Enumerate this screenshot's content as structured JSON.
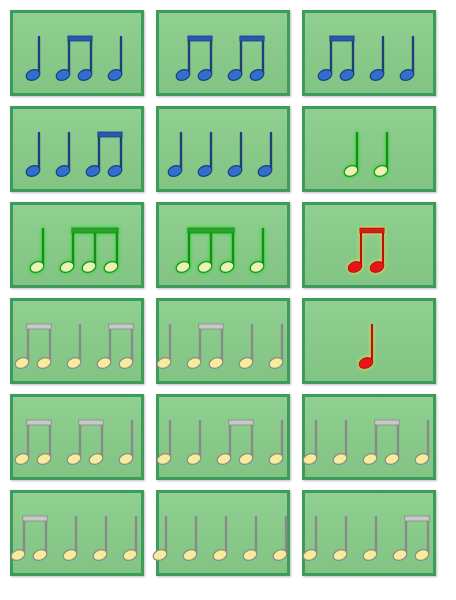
{
  "palette": {
    "blue": {
      "fill": "#2f6fd0",
      "stem": "#1f3f7a",
      "beam": "#2558b5",
      "glow": "none"
    },
    "green": {
      "fill": "#e9f3b4",
      "stem": "#1f8a1f",
      "beam": "#2aa12a",
      "glow": "#19e619"
    },
    "red": {
      "fill": "#e51616",
      "stem": "#c21010",
      "beam": "#d41a1a",
      "glow": "#ffe24a"
    },
    "cream": {
      "fill": "#f6ec9b",
      "stem": "#8a8a8a",
      "beam": "#c9c9c9",
      "glow": "none"
    }
  },
  "cards": [
    {
      "color": "blue",
      "groups": [
        "q",
        "e2",
        "q"
      ]
    },
    {
      "color": "blue",
      "groups": [
        "e2",
        "e2"
      ]
    },
    {
      "color": "blue",
      "groups": [
        "e2",
        "q",
        "q"
      ]
    },
    {
      "color": "blue",
      "groups": [
        "q",
        "q",
        "e2"
      ]
    },
    {
      "color": "blue",
      "groups": [
        "q",
        "q",
        "q",
        "q"
      ]
    },
    {
      "color": "green",
      "groups": [
        "q",
        "q"
      ]
    },
    {
      "color": "green",
      "groups": [
        "q",
        "e3"
      ]
    },
    {
      "color": "green",
      "groups": [
        "e3",
        "q"
      ]
    },
    {
      "color": "red",
      "groups": [
        "e2"
      ]
    },
    {
      "color": "cream",
      "groups": [
        "e2",
        "q",
        "e2"
      ]
    },
    {
      "color": "cream",
      "groups": [
        "q",
        "e2",
        "q",
        "q"
      ]
    },
    {
      "color": "red",
      "groups": [
        "q"
      ]
    },
    {
      "color": "cream",
      "groups": [
        "e2",
        "e2",
        "q"
      ]
    },
    {
      "color": "cream",
      "groups": [
        "q",
        "q",
        "e2",
        "q"
      ]
    },
    {
      "color": "cream",
      "groups": [
        "q",
        "q",
        "e2",
        "q"
      ]
    },
    {
      "color": "cream",
      "groups": [
        "e2",
        "q",
        "q",
        "q"
      ]
    },
    {
      "color": "cream",
      "groups": [
        "q",
        "q",
        "q",
        "q",
        "q"
      ]
    },
    {
      "color": "cream",
      "groups": [
        "q",
        "q",
        "q",
        "e2"
      ]
    }
  ]
}
